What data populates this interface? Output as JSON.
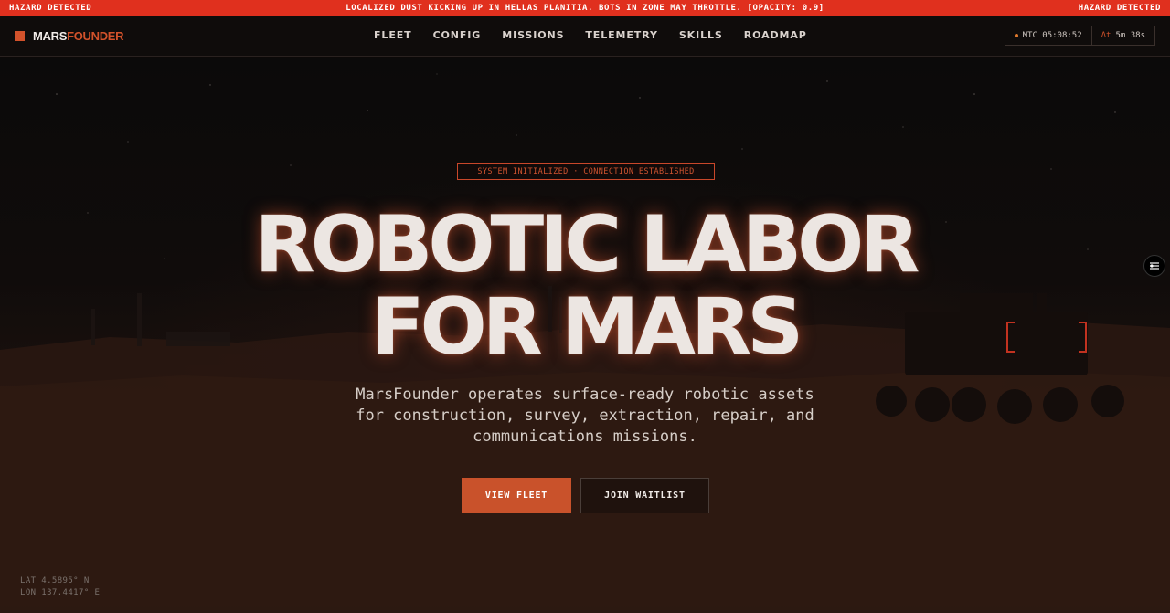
{
  "hazard_bar": {
    "left_label": "HAZARD DETECTED",
    "message": "LOCALIZED DUST KICKING UP IN HELLAS PLANITIA. BOTS IN ZONE MAY THROTTLE. [OPACITY: 0.9]",
    "right_label": "HAZARD DETECTED"
  },
  "brand": {
    "name_part1": "MARS",
    "name_part2": "FOUNDER"
  },
  "nav": {
    "items": [
      {
        "label": "FLEET"
      },
      {
        "label": "CONFIG"
      },
      {
        "label": "MISSIONS"
      },
      {
        "label": "TELEMETRY"
      },
      {
        "label": "SKILLS"
      },
      {
        "label": "ROADMAP"
      }
    ]
  },
  "clock": {
    "mtc": "MTC 05:08:52",
    "delta_symbol": "Δt",
    "delta_value": "5m 38s"
  },
  "hero": {
    "status_badge": "SYSTEM INITIALIZED · CONNECTION ESTABLISHED",
    "headline_line1": "ROBOTIC LABOR",
    "headline_line2": "FOR MARS",
    "subtitle": "MarsFounder operates surface-ready robotic assets for construction, survey, extraction, repair, and communications missions.",
    "primary_button": "VIEW FLEET",
    "secondary_button": "JOIN WAITLIST"
  },
  "coordinates": {
    "lat": "LAT 4.5895° N",
    "lon": "LON 137.4417° E"
  },
  "colors": {
    "accent": "#d2522b",
    "hazard": "#e0301e",
    "background": "#0c0908"
  },
  "icons": {
    "side_button": "sliders-icon"
  }
}
